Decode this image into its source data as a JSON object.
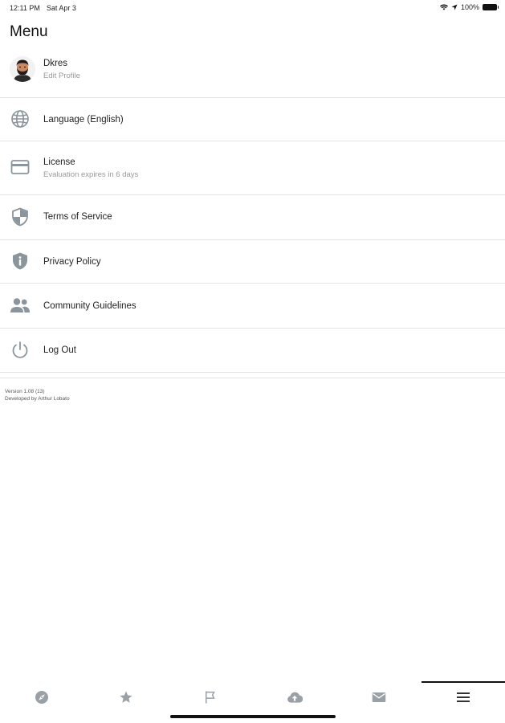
{
  "status_bar": {
    "time": "12:11 PM",
    "date": "Sat Apr 3",
    "battery": "100%"
  },
  "page": {
    "title": "Menu"
  },
  "profile": {
    "name": "Dkres",
    "subtitle": "Edit Profile"
  },
  "menu": {
    "language": {
      "label": "Language (English)",
      "icon": "globe-icon"
    },
    "license": {
      "label": "License",
      "subtitle": "Evaluation expires in 6 days",
      "icon": "credit-card-icon"
    },
    "terms": {
      "label": "Terms of Service",
      "icon": "shield-icon"
    },
    "privacy": {
      "label": "Privacy Policy",
      "icon": "shield-info-icon"
    },
    "community": {
      "label": "Community Guidelines",
      "icon": "people-icon"
    },
    "logout": {
      "label": "Log Out",
      "icon": "power-icon"
    }
  },
  "footer": {
    "version": "Version 1.08 (13)",
    "developer": "Developed by Arthur Lobato"
  },
  "tab_bar": {
    "tabs": [
      {
        "icon": "compass-icon",
        "active": false
      },
      {
        "icon": "star-icon",
        "active": false
      },
      {
        "icon": "flag-icon",
        "active": false
      },
      {
        "icon": "cloud-upload-icon",
        "active": false
      },
      {
        "icon": "mail-icon",
        "active": false
      },
      {
        "icon": "menu-icon",
        "active": true
      }
    ]
  },
  "colors": {
    "icon_gray": "#8a959c",
    "divider": "#e4e4e4",
    "text_primary": "#222222",
    "text_secondary": "#999999"
  }
}
